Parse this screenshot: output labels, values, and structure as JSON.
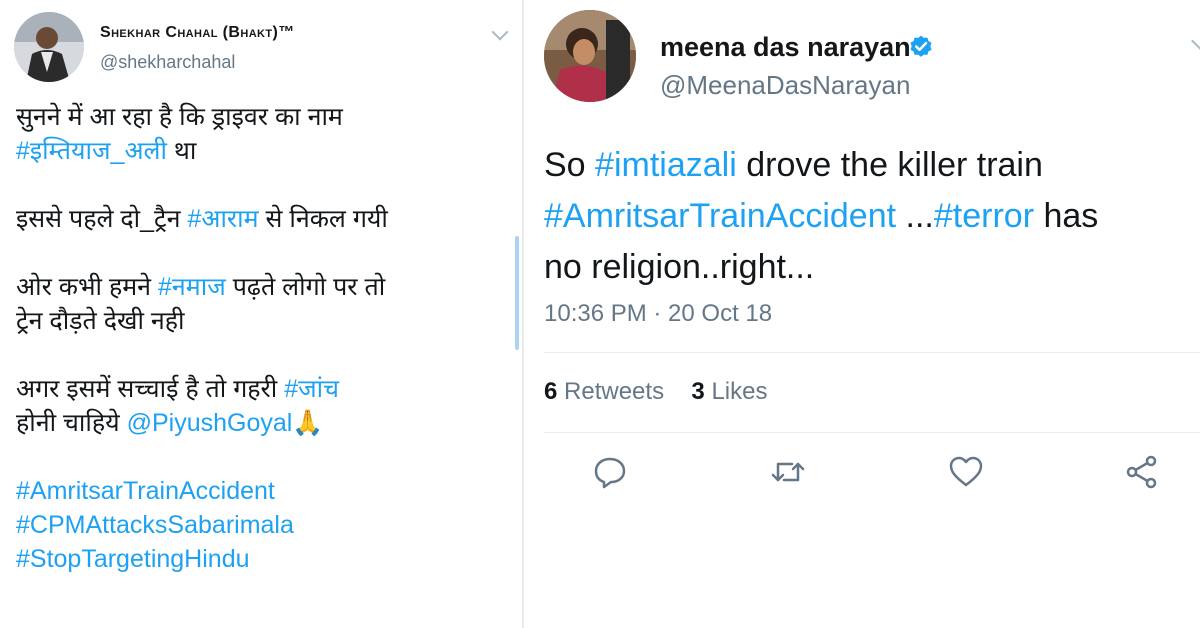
{
  "left_tweet": {
    "name": "Shekhar Chahal (Bhakt)™",
    "handle": "@shekharchahal",
    "lines": {
      "l1": "सुनने में आ रहा है कि ड्राइवर का नाम",
      "l2_tag": "#इम्तियाज_अली",
      "l2_rest": " था",
      "l3_pre": "इससे पहले दो_ट्रैन ",
      "l3_tag": "#आराम",
      "l3_rest": " से निकल गयी",
      "l4_pre": "ओर कभी हमने ",
      "l4_tag": "#नमाज",
      "l4_rest": " पढ़ते लोगो पर तो",
      "l5": "ट्रेन दौड़ते देखी नही",
      "l6_pre": "अगर इसमें सच्चाई है तो गहरी ",
      "l6_tag": "#जांच",
      "l7_pre": "होनी चाहिये ",
      "l7_mention": "@PiyushGoyal",
      "l7_emoji": "🙏",
      "tag_a": "#AmritsarTrainAccident",
      "tag_b": "#CPMAttacksSabarimala",
      "tag_c": "#StopTargetingHindu"
    }
  },
  "right_tweet": {
    "name": "meena das narayan",
    "handle": "@MeenaDasNarayan",
    "text": {
      "r1_pre": "So ",
      "r1_tag": "#imtiazali",
      "r1_rest": " drove the killer train",
      "r2_tag": "#AmritsarTrainAccident",
      "r2_mid": " ...",
      "r2_tag2": "#terror",
      "r2_rest": " has",
      "r3": "no religion..right..."
    },
    "timestamp": "10:36 PM · 20 Oct 18",
    "retweets_count": "6",
    "retweets_label": "Retweets",
    "likes_count": "3",
    "likes_label": "Likes"
  },
  "colors": {
    "link": "#1da1f2",
    "secondary": "#657786",
    "divider": "#e6ecf0"
  },
  "icons": [
    "reply-icon",
    "retweet-icon",
    "like-icon",
    "share-icon",
    "verified-icon",
    "chevron-down-icon"
  ]
}
